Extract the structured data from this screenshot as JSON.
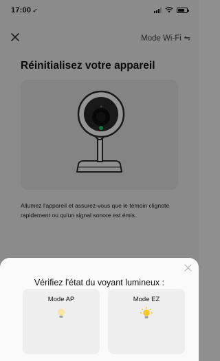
{
  "status_bar": {
    "time": "17:00",
    "location_glyph": "➶",
    "signal_icon": "cellular-signal-icon",
    "wifi_icon": "wifi-icon",
    "battery_icon": "battery-icon"
  },
  "topbar": {
    "close_icon": "close-icon",
    "mode_label": "Mode Wi-Fi",
    "mode_icon_glyph": "⇋"
  },
  "page": {
    "title": "Réinitialisez votre appareil",
    "illustration": "camera-icon",
    "description": "Allumez l'appareil et assurez-vous que le témoin clignote rapidement ou qu'un signal sonore est émis."
  },
  "sheet": {
    "title": "Vérifiez l'état du voyant lumineux :",
    "close_icon": "close-icon",
    "options": [
      {
        "label": "Mode AP",
        "icon": "bulb-dim-icon"
      },
      {
        "label": "Mode EZ",
        "icon": "bulb-blinking-icon"
      }
    ]
  },
  "colors": {
    "overlay": "rgba(0,0,0,0.42)",
    "sheet_bg": "#fafafa",
    "card_bg": "#eeeeee",
    "bulb_light": "#f7e6a8",
    "bulb_bright": "#f7c72e",
    "camera_led": "#22c55e"
  }
}
